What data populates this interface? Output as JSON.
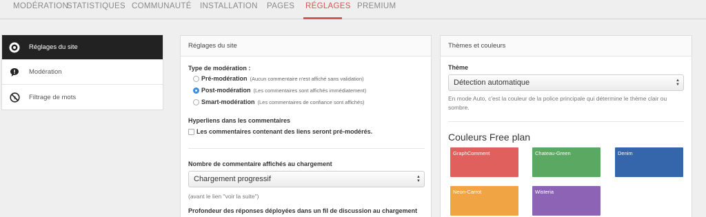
{
  "nav": {
    "tabs": [
      {
        "label": "MODÉRATION",
        "active": false
      },
      {
        "label": "STATISTIQUES",
        "active": false
      },
      {
        "label": "COMMUNAUTÉ",
        "active": false
      },
      {
        "label": "INSTALLATION",
        "active": false
      },
      {
        "label": "PAGES",
        "active": false
      },
      {
        "label": "RÉGLAGES",
        "active": true
      },
      {
        "label": "PREMIUM",
        "active": false
      }
    ]
  },
  "sidebar": {
    "items": [
      {
        "label": "Réglages du site",
        "icon": "target-icon",
        "active": true
      },
      {
        "label": "Modération",
        "icon": "speech-bubble-icon",
        "active": false
      },
      {
        "label": "Filtrage de mots",
        "icon": "prohibited-icon",
        "active": false
      }
    ]
  },
  "site_settings": {
    "title": "Réglages du site",
    "moderation_type_label": "Type de modération :",
    "moderation_options": [
      {
        "label": "Pré-modération",
        "desc": "(Aucun commentaire n'est affiché sans validation)",
        "selected": false
      },
      {
        "label": "Post-modération",
        "desc": "(Les commentaires sont affichés immédiatement)",
        "selected": true
      },
      {
        "label": "Smart-modération",
        "desc": "(Les commentaires de confiance sont affichés)",
        "selected": false
      }
    ],
    "hyperlinks_label": "Hyperliens dans les commentaires",
    "hyperlinks_checkbox": "Les commentaires contenant des liens seront pré-modérés.",
    "load_count_label": "Nombre de commentaire affichés au chargement",
    "load_count_value": "Chargement progressif",
    "load_count_help": "(avant le lien \"voir la suite\")",
    "depth_label": "Profondeur des réponses déployées dans un fil de discussion au chargement"
  },
  "themes": {
    "title": "Thèmes et couleurs",
    "theme_label": "Thème",
    "theme_value": "Détection automatique",
    "theme_help": "En mode Auto, c'est la couleur de la police principale qui détermine le thème clair ou sombre.",
    "free_heading": "Couleurs Free plan",
    "colors": [
      {
        "name": "GraphComment",
        "hex": "#e0605e"
      },
      {
        "name": "Chateau-Green",
        "hex": "#5aa862"
      },
      {
        "name": "Denim",
        "hex": "#3566ac"
      },
      {
        "name": "Neon-Carrot",
        "hex": "#f0a443"
      },
      {
        "name": "Wisteria",
        "hex": "#8d64b5"
      }
    ]
  },
  "accent": "#d9534f"
}
